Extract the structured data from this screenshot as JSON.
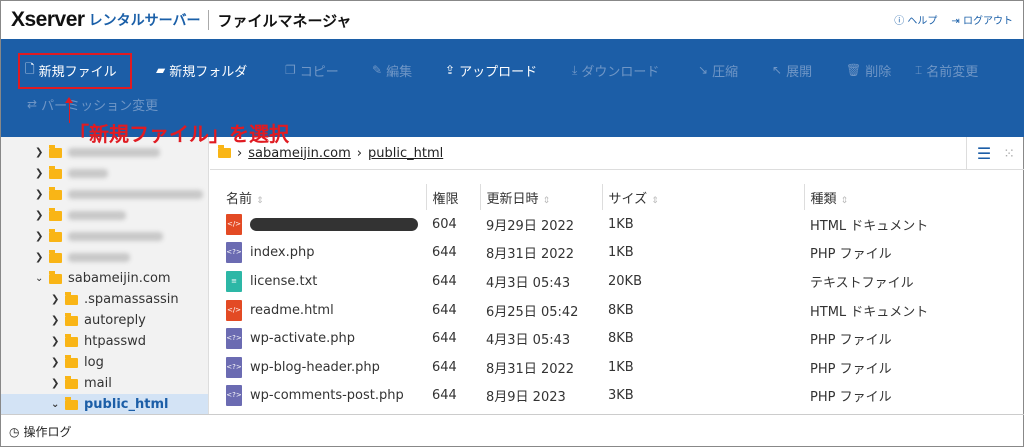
{
  "header": {
    "logo": "Xserver",
    "logo_sub": "レンタルサーバー",
    "app_title": "ファイルマネージャ",
    "help": "ヘルプ",
    "logout": "ログアウト"
  },
  "toolbar": {
    "items": [
      {
        "label": "新規ファイル",
        "icon": "new-file-icon",
        "enabled": true
      },
      {
        "label": "新規フォルダ",
        "icon": "new-folder-icon",
        "enabled": true
      },
      {
        "label": "コピー",
        "icon": "copy-icon",
        "enabled": false
      },
      {
        "label": "編集",
        "icon": "pencil-icon",
        "enabled": false
      },
      {
        "label": "アップロード",
        "icon": "upload-icon",
        "enabled": true
      },
      {
        "label": "ダウンロード",
        "icon": "download-icon",
        "enabled": false
      },
      {
        "label": "圧縮",
        "icon": "compress-icon",
        "enabled": false
      },
      {
        "label": "展開",
        "icon": "expand-icon",
        "enabled": false
      },
      {
        "label": "削除",
        "icon": "trash-icon",
        "enabled": false
      },
      {
        "label": "名前変更",
        "icon": "rename-icon",
        "enabled": false
      },
      {
        "label": "パーミッション変更",
        "icon": "permission-icon",
        "enabled": false
      }
    ]
  },
  "annotation": "「新規ファイル」を選択",
  "tree": {
    "domain": "sabameijin.com",
    "children": [
      ".spamassassin",
      "autoreply",
      "htpasswd",
      "log",
      "mail",
      "public_html"
    ]
  },
  "breadcrumb": [
    "sabameijin.com",
    "public_html"
  ],
  "table": {
    "headers": [
      "名前",
      "権限",
      "更新日時",
      "サイズ",
      "種類"
    ],
    "rows": [
      {
        "name": "",
        "perm": "604",
        "date": "9月29日 2022",
        "size": "1KB",
        "type": "HTML ドキュメント",
        "icon": "html"
      },
      {
        "name": "index.php",
        "perm": "644",
        "date": "8月31日 2022",
        "size": "1KB",
        "type": "PHP ファイル",
        "icon": "php"
      },
      {
        "name": "license.txt",
        "perm": "644",
        "date": "4月3日 05:43",
        "size": "20KB",
        "type": "テキストファイル",
        "icon": "txt"
      },
      {
        "name": "readme.html",
        "perm": "644",
        "date": "6月25日 05:42",
        "size": "8KB",
        "type": "HTML ドキュメント",
        "icon": "html"
      },
      {
        "name": "wp-activate.php",
        "perm": "644",
        "date": "4月3日 05:43",
        "size": "8KB",
        "type": "PHP ファイル",
        "icon": "php"
      },
      {
        "name": "wp-blog-header.php",
        "perm": "644",
        "date": "8月31日 2022",
        "size": "1KB",
        "type": "PHP ファイル",
        "icon": "php"
      },
      {
        "name": "wp-comments-post.php",
        "perm": "644",
        "date": "8月9日 2023",
        "size": "3KB",
        "type": "PHP ファイル",
        "icon": "php"
      }
    ]
  },
  "footer": {
    "label": "操作ログ"
  }
}
